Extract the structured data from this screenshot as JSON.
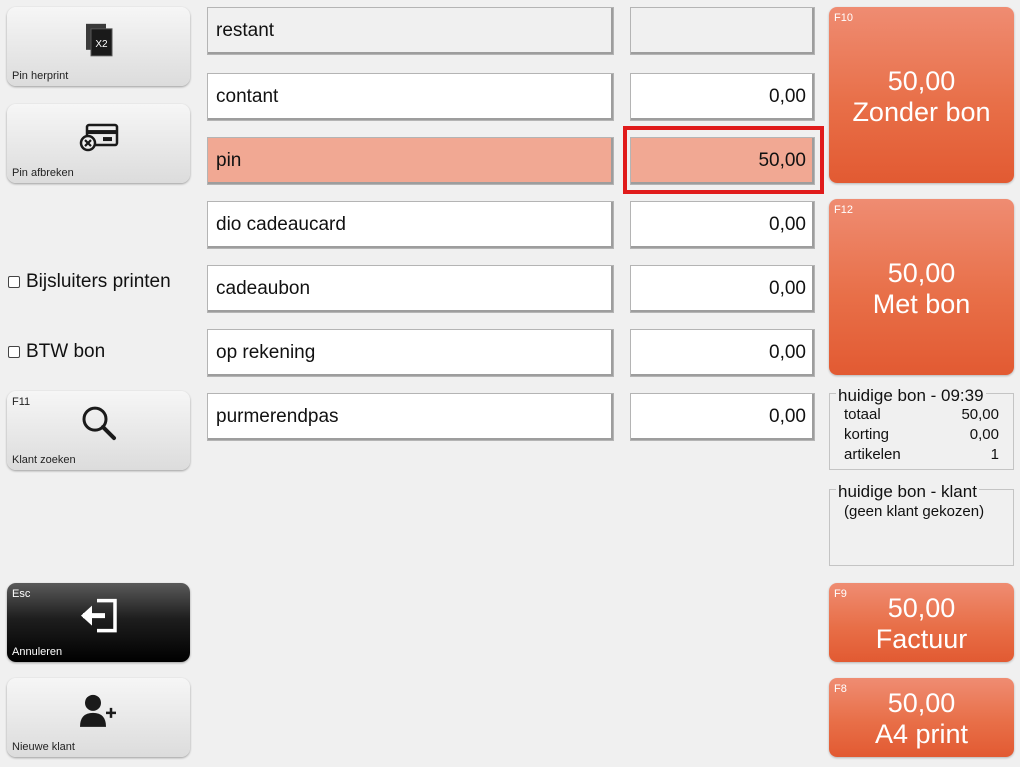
{
  "left_buttons": {
    "pin_reprint": {
      "label": "Pin herprint",
      "icon": "reprint-x2-icon",
      "badge": "X2"
    },
    "pin_cancel": {
      "label": "Pin afbreken",
      "icon": "card-cancel-icon"
    },
    "customer_search": {
      "key": "F11",
      "label": "Klant zoeken",
      "icon": "search-icon"
    },
    "cancel": {
      "key": "Esc",
      "label": "Annuleren",
      "icon": "exit-icon"
    },
    "new_customer": {
      "label": "Nieuwe klant",
      "icon": "add-user-icon"
    }
  },
  "checkboxes": {
    "leaflets": {
      "label": "Bijsluiters printen",
      "checked": false
    },
    "vat_receipt": {
      "label": "BTW bon",
      "checked": false
    }
  },
  "payments": {
    "remaining": {
      "label": "restant",
      "amount": ""
    },
    "rows": [
      {
        "label": "contant",
        "amount": "0,00"
      },
      {
        "label": "pin",
        "amount": "50,00"
      },
      {
        "label": "dio cadeaucard",
        "amount": "0,00"
      },
      {
        "label": "cadeaubon",
        "amount": "0,00"
      },
      {
        "label": "op rekening",
        "amount": "0,00"
      },
      {
        "label": "purmerendpas",
        "amount": "0,00"
      }
    ]
  },
  "right_buttons": {
    "without_receipt": {
      "key": "F10",
      "amount": "50,00",
      "label": "Zonder bon"
    },
    "with_receipt": {
      "key": "F12",
      "amount": "50,00",
      "label": "Met bon"
    },
    "invoice": {
      "key": "F9",
      "amount": "50,00",
      "label": "Factuur"
    },
    "a4_print": {
      "key": "F8",
      "amount": "50,00",
      "label": "A4 print"
    }
  },
  "receipt_summary": {
    "title": "huidige bon - 09:39",
    "rows": [
      {
        "label": "totaal",
        "value": "50,00"
      },
      {
        "label": "korting",
        "value": "0,00"
      },
      {
        "label": "artikelen",
        "value": "1"
      }
    ]
  },
  "receipt_customer": {
    "title": "huidige bon - klant",
    "value": "(geen klant gekozen)"
  },
  "colors": {
    "accent": "#e86f48",
    "selected_row": "#f1a893",
    "highlight_border": "#e01b1b"
  }
}
